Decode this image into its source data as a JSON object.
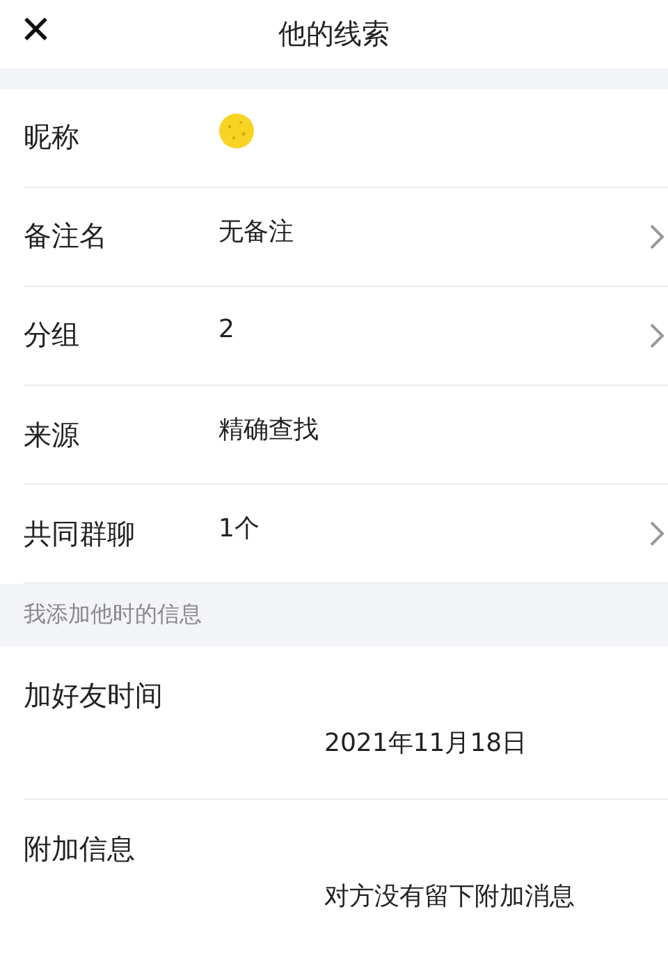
{
  "header": {
    "close_glyph": "✕",
    "title": "他的线索"
  },
  "rows": [
    {
      "label": "昵称",
      "kind": "emoji",
      "chevron": false
    },
    {
      "label": "备注名",
      "value": "无备注",
      "kind": "text",
      "chevron": true
    },
    {
      "label": "分组",
      "value": "2",
      "kind": "text",
      "chevron": true
    },
    {
      "label": "来源",
      "value": "精确查找",
      "kind": "text",
      "chevron": false
    },
    {
      "label": "共同群聊",
      "value": "1个",
      "kind": "text",
      "chevron": true
    }
  ],
  "section_title": "我添加他时的信息",
  "details": [
    {
      "label": "加好友时间",
      "value": "2021年11月18日"
    },
    {
      "label": "附加信息",
      "value": "对方没有留下附加消息"
    }
  ]
}
